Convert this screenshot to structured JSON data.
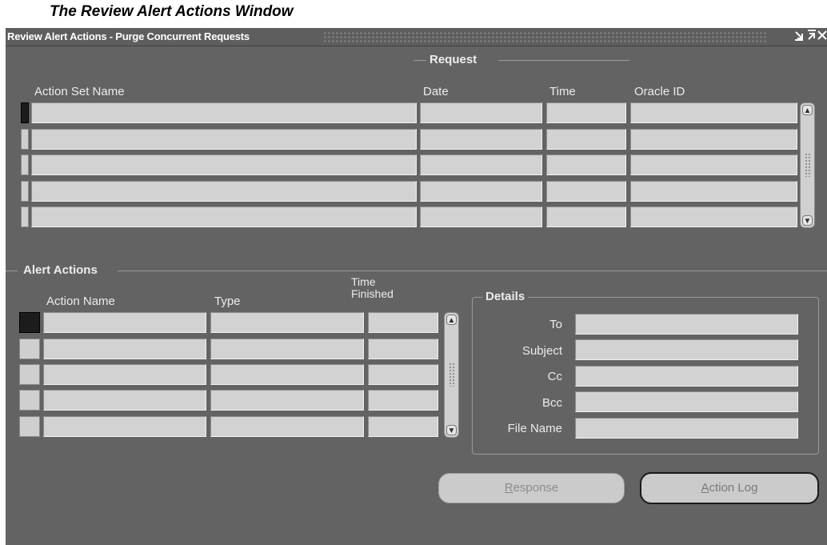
{
  "caption": "The Review Alert Actions Window",
  "window": {
    "title": "Review Alert Actions - Purge Concurrent Requests",
    "icons": [
      "minimize-icon",
      "maximize-icon",
      "close-icon"
    ]
  },
  "request": {
    "group_label": "Request",
    "columns": {
      "action_set_name": "Action Set Name",
      "date": "Date",
      "time": "Time",
      "oracle_id": "Oracle ID"
    },
    "rows": [
      {
        "action_set_name": "",
        "date": "",
        "time": "",
        "oracle_id": ""
      },
      {
        "action_set_name": "",
        "date": "",
        "time": "",
        "oracle_id": ""
      },
      {
        "action_set_name": "",
        "date": "",
        "time": "",
        "oracle_id": ""
      },
      {
        "action_set_name": "",
        "date": "",
        "time": "",
        "oracle_id": ""
      },
      {
        "action_set_name": "",
        "date": "",
        "time": "",
        "oracle_id": ""
      }
    ]
  },
  "alert_actions": {
    "group_label": "Alert Actions",
    "columns": {
      "action_name": "Action Name",
      "type": "Type",
      "time_finished_line1": "Time",
      "time_finished_line2": "Finished"
    },
    "rows": [
      {
        "action_name": "",
        "type": "",
        "time_finished": ""
      },
      {
        "action_name": "",
        "type": "",
        "time_finished": ""
      },
      {
        "action_name": "",
        "type": "",
        "time_finished": ""
      },
      {
        "action_name": "",
        "type": "",
        "time_finished": ""
      },
      {
        "action_name": "",
        "type": "",
        "time_finished": ""
      }
    ]
  },
  "details": {
    "group_label": "Details",
    "fields": {
      "to": {
        "label": "To",
        "value": ""
      },
      "subject": {
        "label": "Subject",
        "value": ""
      },
      "cc": {
        "label": "Cc",
        "value": ""
      },
      "bcc": {
        "label": "Bcc",
        "value": ""
      },
      "file_name": {
        "label": "File Name",
        "value": ""
      }
    }
  },
  "buttons": {
    "response": {
      "mnemonic": "R",
      "rest": "esponse"
    },
    "action_log": {
      "mnemonic": "A",
      "rest": "ction Log"
    }
  },
  "colors": {
    "window_bg": "#636363",
    "field_bg": "#d2d2d2",
    "current_record": "#1c1c1c"
  }
}
